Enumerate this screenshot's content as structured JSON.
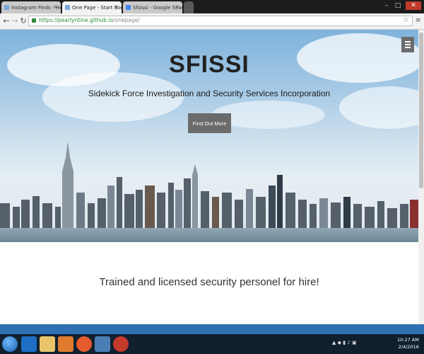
{
  "browser": {
    "tabs": [
      {
        "label": "Instagram Finds - Help Ur...",
        "active": false
      },
      {
        "label": "One Page - Start Bootstr...",
        "active": true
      },
      {
        "label": "Sfsissi - Google Search",
        "active": false
      }
    ],
    "url_host": "https://pearlyntine.github.io",
    "url_path": "/onepage/"
  },
  "page": {
    "title": "SFISSI",
    "subtitle": "Sidekick Force Investigation and Security Services Incorporation",
    "cta_label": "Find Out More",
    "tagline": "Trained and licensed security personel for hire!"
  },
  "taskbar": {
    "time": "10:27 AM",
    "date": "2/4/2016"
  },
  "colors": {
    "button_gray": "#6b6b6b",
    "blue_band": "#2f6fb3",
    "url_green": "#2e8b3c"
  }
}
